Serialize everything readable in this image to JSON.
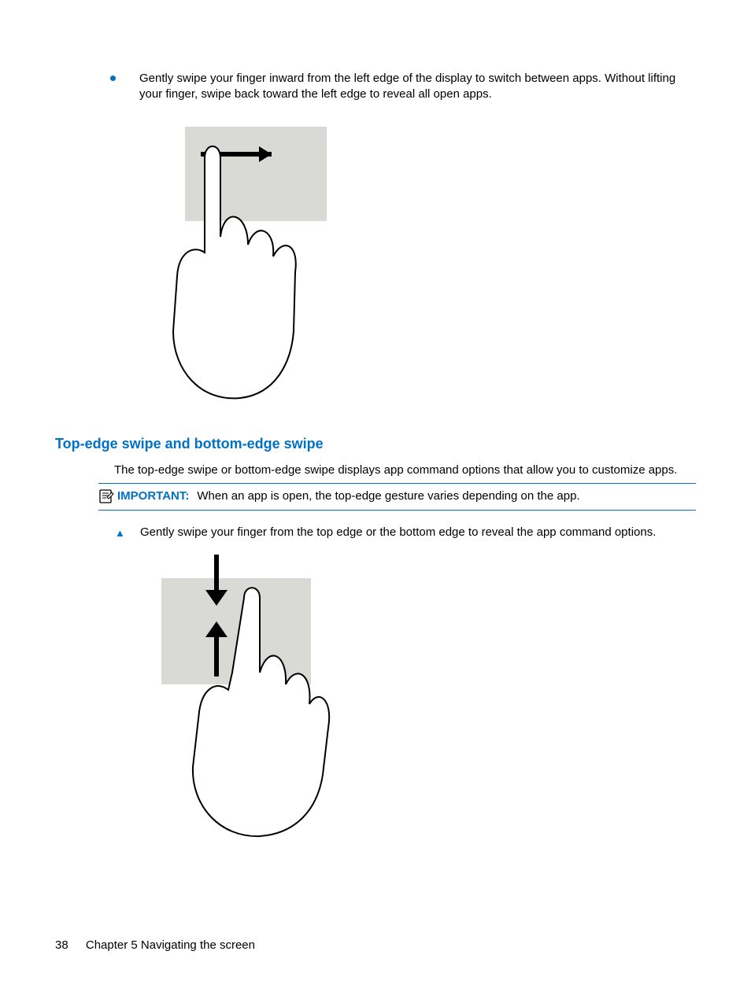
{
  "bullet1": {
    "text": "Gently swipe your finger inward from the left edge of the display to switch between apps. Without lifting your finger, swipe back toward the left edge to reveal all open apps."
  },
  "heading": "Top-edge swipe and bottom-edge swipe",
  "paragraph1": "The top-edge swipe or bottom-edge swipe displays app command options that allow you to customize apps.",
  "important": {
    "label": "IMPORTANT:",
    "text": "When an app is open, the top-edge gesture varies depending on the app."
  },
  "step1": {
    "text": "Gently swipe your finger from the top edge or the bottom edge to reveal the app command options."
  },
  "footer": {
    "page_number": "38",
    "chapter": "Chapter 5   Navigating the screen"
  },
  "icons": {
    "bullet": "bullet-dot-icon",
    "note": "note-icon",
    "triangle": "step-triangle-icon",
    "fig1": "left-edge-swipe-gesture-illustration",
    "fig2": "top-bottom-edge-swipe-gesture-illustration"
  }
}
